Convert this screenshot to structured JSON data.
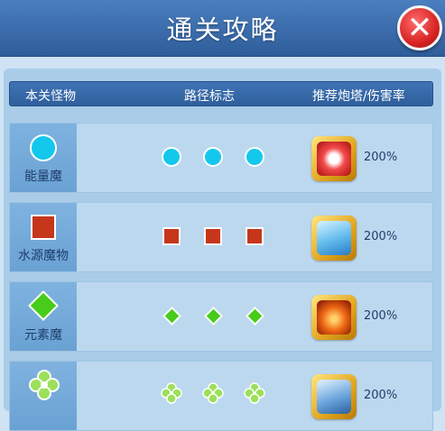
{
  "window": {
    "title": "通关攻略"
  },
  "columns": {
    "monster": "本关怪物",
    "path": "路径标志",
    "tower": "推荐炮塔/伤害率"
  },
  "rows": [
    {
      "monster_name": "能量魔",
      "mark_icon": "circle-icon",
      "mark_color": "#13c8ec",
      "tower_icon": "fire-cannon-tower-icon",
      "damage_rate": "200%"
    },
    {
      "monster_name": "水源魔物",
      "mark_icon": "square-icon",
      "mark_color": "#c6361b",
      "tower_icon": "ice-sword-tower-icon",
      "damage_rate": "200%"
    },
    {
      "monster_name": "元素魔",
      "mark_icon": "diamond-icon",
      "mark_color": "#46cc19",
      "tower_icon": "flame-burst-tower-icon",
      "damage_rate": "200%"
    },
    {
      "monster_name": "",
      "mark_icon": "clover-icon",
      "mark_color": "#9be05a",
      "tower_icon": "shield-tower-icon",
      "damage_rate": "200%"
    }
  ],
  "colors": {
    "header": "#3a6aa9",
    "panel": "#a9cde9",
    "close": "#d92424"
  }
}
